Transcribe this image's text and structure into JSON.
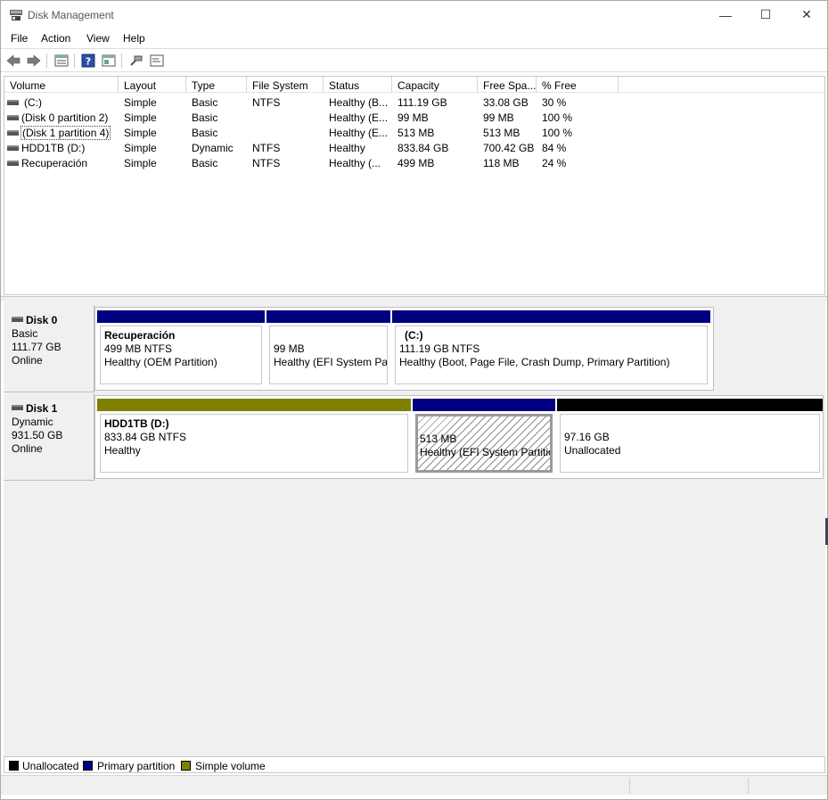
{
  "window": {
    "title": "Disk Management",
    "controls": {
      "minimize": "—",
      "maximize": "☐",
      "close": "✕"
    }
  },
  "menu": [
    "File",
    "Action",
    "View",
    "Help"
  ],
  "toolbar": {
    "icons": [
      "back-arrow-icon",
      "forward-arrow-icon",
      "disk-list-icon",
      "help-icon",
      "properties-icon",
      "connect-icon",
      "view-icon"
    ]
  },
  "volume_table": {
    "columns": [
      "Volume",
      "Layout",
      "Type",
      "File System",
      "Status",
      "Capacity",
      "Free Spa...",
      "% Free"
    ],
    "rows": [
      [
        "(C:)",
        "Simple",
        "Basic",
        "NTFS",
        "Healthy (B...",
        "111.19 GB",
        "33.08 GB",
        "30 %"
      ],
      [
        "(Disk 0 partition 2)",
        "Simple",
        "Basic",
        "",
        "Healthy (E...",
        "99 MB",
        "99 MB",
        "100 %"
      ],
      [
        "(Disk 1 partition 4)",
        "Simple",
        "Basic",
        "",
        "Healthy (E...",
        "513 MB",
        "513 MB",
        "100 %"
      ],
      [
        "HDD1TB (D:)",
        "Simple",
        "Dynamic",
        "NTFS",
        "Healthy",
        "833.84 GB",
        "700.42 GB",
        "84 %"
      ],
      [
        "Recuperación",
        "Simple",
        "Basic",
        "NTFS",
        "Healthy (...",
        "499 MB",
        "118 MB",
        "24 %"
      ]
    ]
  },
  "disks": [
    {
      "name": "Disk 0",
      "type": "Basic",
      "size": "111.77 GB",
      "state": "Online",
      "partitions": [
        {
          "title": "Recuperación",
          "size_fs": "499 MB NTFS",
          "status": "Healthy (OEM Partition)",
          "bar_color": "#000080"
        },
        {
          "title": "",
          "size_fs": "99 MB",
          "status": "Healthy (EFI System Par",
          "bar_color": "#000080"
        },
        {
          "title": "(C:)",
          "size_fs": "111.19 GB NTFS",
          "status": "Healthy (Boot, Page File, Crash Dump, Primary Partition)",
          "bar_color": "#000080"
        }
      ]
    },
    {
      "name": "Disk 1",
      "type": "Dynamic",
      "size": "931.50 GB",
      "state": "Online",
      "partitions": [
        {
          "title": "HDD1TB  (D:)",
          "size_fs": "833.84 GB NTFS",
          "status": "Healthy",
          "bar_color": "#808000"
        },
        {
          "title": "",
          "size_fs": "513 MB",
          "status": "Healthy (EFI System Partitio",
          "bar_color": "#000080"
        },
        {
          "title": "",
          "size_fs": "97.16 GB",
          "status": "Unallocated",
          "bar_color": "#000000"
        }
      ]
    }
  ],
  "legend": [
    {
      "label": "Unallocated",
      "color": "#000000"
    },
    {
      "label": "Primary partition",
      "color": "#000080"
    },
    {
      "label": "Simple volume",
      "color": "#808000"
    }
  ]
}
